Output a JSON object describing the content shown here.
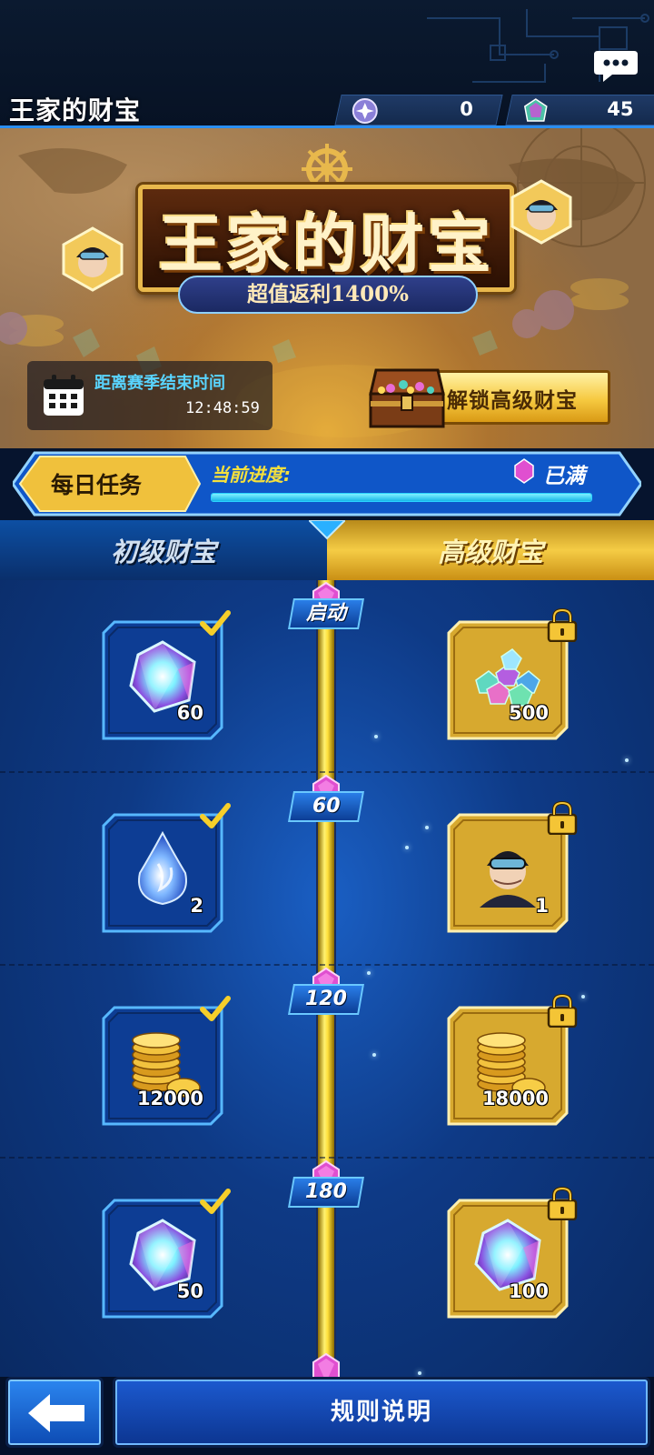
{
  "header": {
    "title": "王家的财宝",
    "currency_orbs": "0",
    "currency_gems": "45"
  },
  "banner": {
    "logo_title": "王家的财宝",
    "logo_subtitle": "超值返利1400%",
    "timer_label": "距离赛季结束时间",
    "timer_value": "12:48:59",
    "unlock_button": "解锁高级财宝"
  },
  "task": {
    "daily_label": "每日任务",
    "progress_label": "当前进度:",
    "progress_status": "已满",
    "progress_fraction": 1.0
  },
  "tabs": {
    "basic": "初级财宝",
    "advanced": "高级财宝"
  },
  "rows": [
    {
      "milestone": "启动",
      "basic_item": "gem-icon",
      "basic_qty": "60",
      "basic_claimed": true,
      "adv_item": "gem-pile-icon",
      "adv_qty": "500",
      "adv_locked": true
    },
    {
      "milestone": "60",
      "basic_item": "blue-flame-orb-icon",
      "basic_qty": "2",
      "basic_claimed": true,
      "adv_item": "character-avatar-icon",
      "adv_qty": "1",
      "adv_locked": true
    },
    {
      "milestone": "120",
      "basic_item": "gold-coins-icon",
      "basic_qty": "12000",
      "basic_claimed": true,
      "adv_item": "gold-coins-icon",
      "adv_qty": "18000",
      "adv_locked": true
    },
    {
      "milestone": "180",
      "basic_item": "gem-icon",
      "basic_qty": "50",
      "basic_claimed": true,
      "adv_item": "gem-icon",
      "adv_qty": "100",
      "adv_locked": true
    }
  ],
  "footer": {
    "rules_button": "规则说明"
  },
  "colors": {
    "accent_blue": "#2b8ef0",
    "gold": "#f5cc45",
    "progress_cyan": "#18b7e8",
    "milestone_gem": "#e04fd0"
  }
}
